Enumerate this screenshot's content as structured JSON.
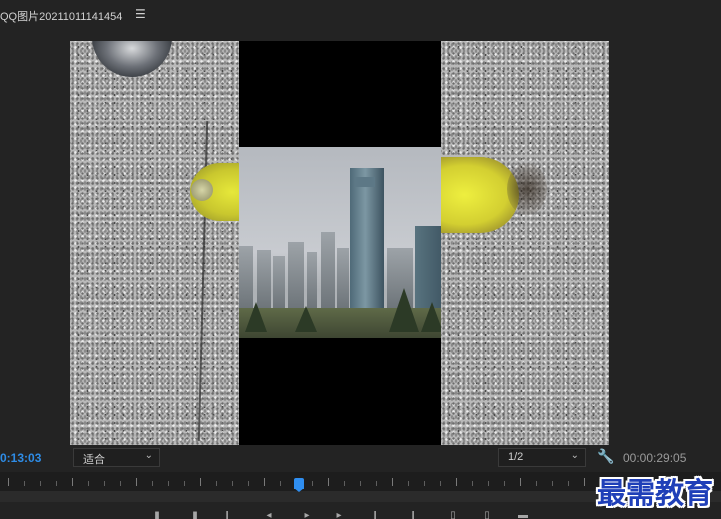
{
  "panel": {
    "title": "QQ图片20211011141454",
    "menu_icon": "hamburger-menu-icon"
  },
  "viewer": {
    "content": "program-monitor-frame"
  },
  "controls": {
    "current_timecode": "0:13:03",
    "zoom_level": "适合",
    "resolution": "1/2",
    "settings_icon": "wrench-icon",
    "duration_timecode": "00:00:29:05"
  },
  "timeline": {
    "playhead_icon": "playhead-marker"
  },
  "transport": {
    "buttons": [
      "mark-in-icon",
      "mark-out-icon",
      "go-to-in-icon",
      "step-back-icon",
      "play-icon",
      "step-forward-icon",
      "go-to-out-icon",
      "lift-icon",
      "extract-icon",
      "export-frame-icon",
      "button-editor-icon"
    ]
  },
  "watermark": {
    "text": "最需教育"
  },
  "colors": {
    "accent": "#2e8ce6",
    "background": "#232323",
    "watermark": "#1f3fb8"
  }
}
